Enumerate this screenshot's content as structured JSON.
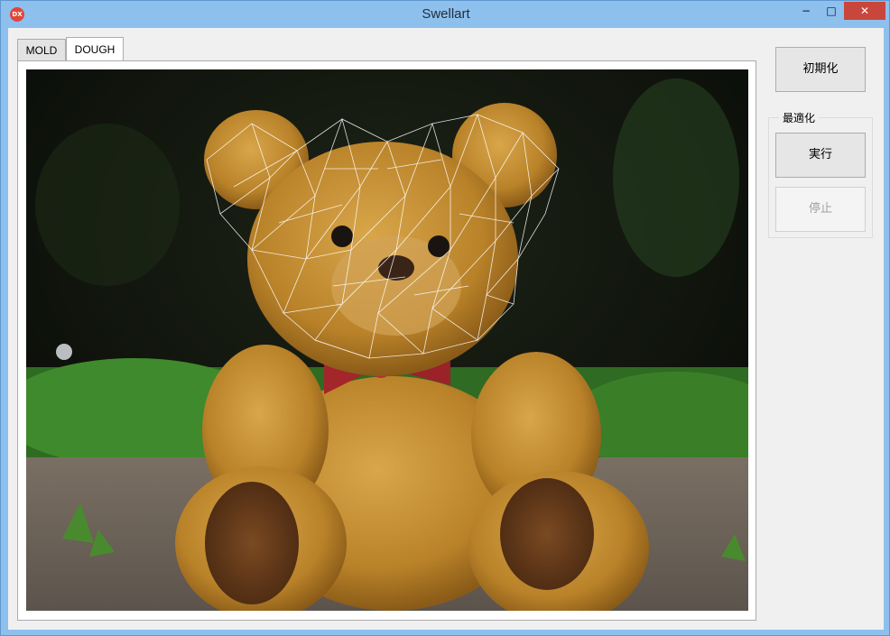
{
  "window": {
    "title": "Swellart",
    "icon": "app-icon",
    "controls": {
      "minimize": "−",
      "maximize": "□",
      "close": "✕"
    }
  },
  "tabs": [
    {
      "label": "MOLD",
      "selected": false
    },
    {
      "label": "DOUGH",
      "selected": true
    }
  ],
  "buttons": {
    "initialize": "初期化",
    "run": "実行",
    "stop": "停止"
  },
  "optimize_group": {
    "label": "最適化"
  },
  "canvas": {
    "content": "teddy-bear-photo",
    "overlay": "triangle-mesh"
  }
}
